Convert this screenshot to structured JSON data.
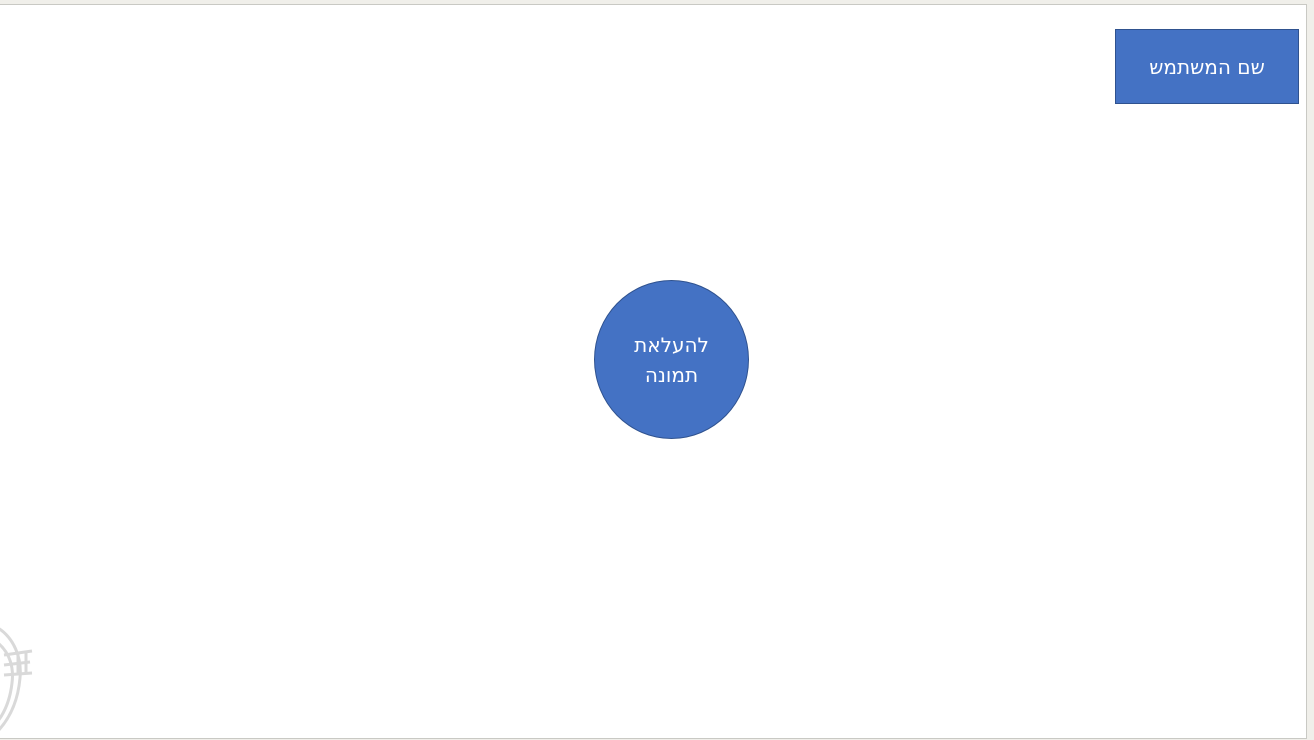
{
  "header": {
    "username_label": "שם המשתמש"
  },
  "main": {
    "upload_label": "להעלאת תמונה"
  },
  "colors": {
    "accent": "#4472c4",
    "accent_border": "#2f528f",
    "background": "#ffffff"
  },
  "icons": {
    "watermark": "logo-watermark-icon"
  }
}
